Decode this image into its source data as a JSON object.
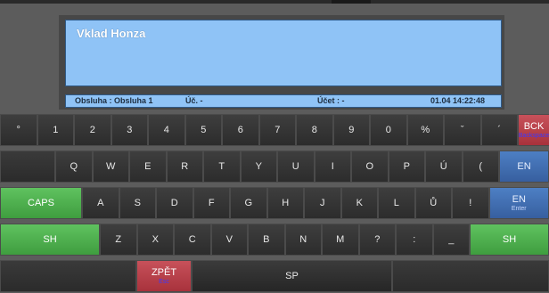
{
  "display": {
    "title": "Vklad Honza",
    "operator": "Obsluha : Obsluha 1",
    "uc": "Úč. -",
    "ucet": "Účet : -",
    "datetime": "01.04 14:22:48"
  },
  "keyboard": {
    "row1": [
      "°",
      "1",
      "2",
      "3",
      "4",
      "5",
      "6",
      "7",
      "8",
      "9",
      "0",
      "%",
      "ˇ",
      "´"
    ],
    "bck": {
      "label": "BCK",
      "sub": "Backspace"
    },
    "row2": [
      "Q",
      "W",
      "E",
      "R",
      "T",
      "Y",
      "U",
      "I",
      "O",
      "P",
      "Ú",
      "("
    ],
    "en1": {
      "label": "EN"
    },
    "caps": {
      "label": "CAPS"
    },
    "row3": [
      "A",
      "S",
      "D",
      "F",
      "G",
      "H",
      "J",
      "K",
      "L",
      "Ů",
      "!"
    ],
    "en2": {
      "label": "EN",
      "sub": "Enter"
    },
    "shift_left": {
      "label": "SH"
    },
    "row4": [
      "Z",
      "X",
      "C",
      "V",
      "B",
      "N",
      "M",
      "?",
      ":",
      "_"
    ],
    "shift_right": {
      "label": "SH"
    },
    "zpet": {
      "label": "ZPĚT",
      "sub": "Esc"
    },
    "space": {
      "label": "SP"
    }
  },
  "colors": {
    "display_bg": "#8fc3f6",
    "key_bg": "#333333",
    "green": "#4caf4c",
    "red": "#b8424b",
    "blue": "#4570b0"
  }
}
